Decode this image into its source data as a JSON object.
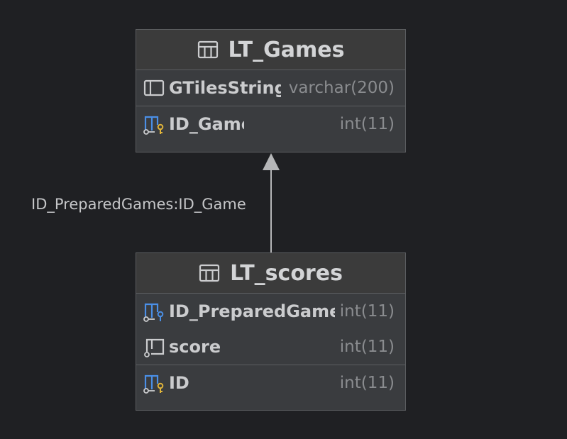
{
  "colors": {
    "background": "#1f2023",
    "entity_body": "#3a3c3f",
    "entity_border": "#5c5e61",
    "text_primary": "#cbccce",
    "text_type": "#8a8c8f",
    "key_blue": "#4a8fe6",
    "key_gold": "#e0b43a",
    "arrow": "#b5b6b8"
  },
  "tables": [
    {
      "title": "LT_Games",
      "icon": "table-icon",
      "sections": [
        [
          {
            "name": "GTilesString",
            "type": "varchar(200)",
            "icon": "column-icon"
          }
        ],
        [
          {
            "name": "ID_Game",
            "type": "int(11)",
            "icon": "primary-key-icon"
          }
        ]
      ]
    },
    {
      "title": "LT_scores",
      "icon": "table-icon",
      "sections": [
        [
          {
            "name": "ID_PreparedGames",
            "type": "int(11)",
            "icon": "foreign-key-icon"
          },
          {
            "name": "score",
            "type": "int(11)",
            "icon": "column-icon"
          }
        ],
        [
          {
            "name": "ID",
            "type": "int(11)",
            "icon": "primary-key-icon"
          }
        ]
      ]
    }
  ],
  "relationship": {
    "label": "ID_PreparedGames:ID_Game",
    "from": "LT_scores",
    "to": "LT_Games"
  }
}
